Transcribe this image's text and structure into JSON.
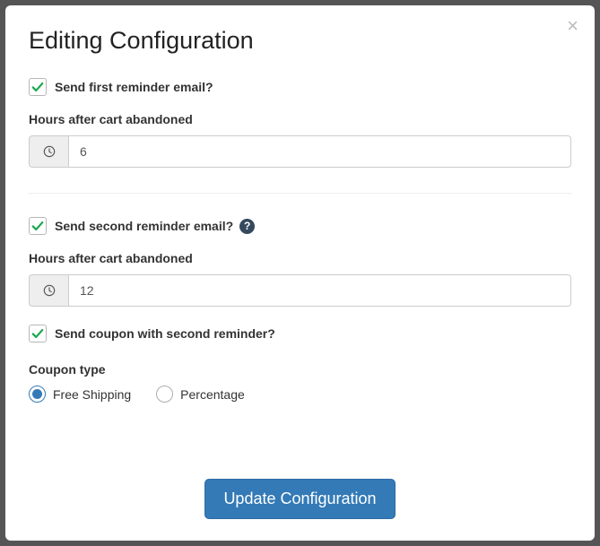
{
  "title": "Editing Configuration",
  "close_label": "×",
  "first": {
    "checkbox_label": "Send first reminder email?",
    "checked": true,
    "hours_label": "Hours after cart abandoned",
    "hours_value": "6"
  },
  "second": {
    "checkbox_label": "Send second reminder email?",
    "checked": true,
    "help_symbol": "?",
    "hours_label": "Hours after cart abandoned",
    "hours_value": "12",
    "coupon_label": "Send coupon with second reminder?",
    "coupon_checked": true
  },
  "coupon_type": {
    "label": "Coupon type",
    "options": [
      {
        "label": "Free Shipping",
        "selected": true
      },
      {
        "label": "Percentage",
        "selected": false
      }
    ]
  },
  "submit_label": "Update Configuration"
}
